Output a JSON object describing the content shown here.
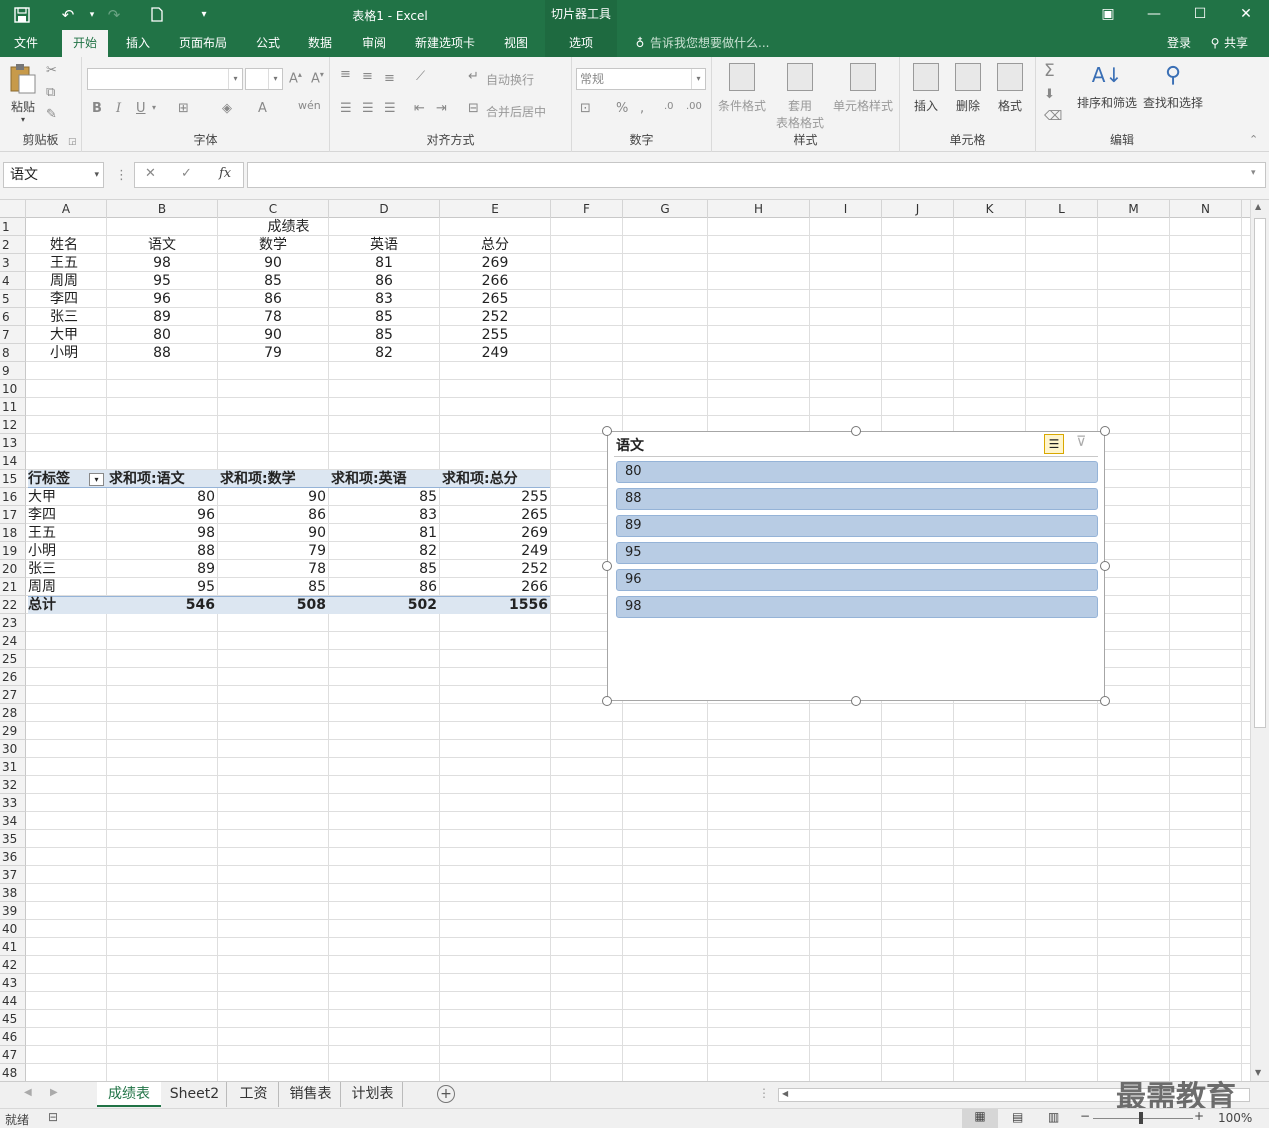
{
  "window": {
    "title": "表格1 - Excel",
    "context_tool": "切片器工具",
    "login": "登录",
    "share": "共享"
  },
  "ribbon_tabs": [
    "文件",
    "开始",
    "插入",
    "页面布局",
    "公式",
    "数据",
    "审阅",
    "新建选项卡",
    "视图",
    "选项"
  ],
  "active_tab": "开始",
  "tell_me": "告诉我您想要做什么...",
  "ribbon": {
    "clipboard": {
      "label": "剪贴板",
      "paste": "粘贴"
    },
    "font": {
      "label": "字体"
    },
    "align": {
      "label": "对齐方式",
      "wrap": "自动换行",
      "merge": "合并后居中"
    },
    "number": {
      "label": "数字",
      "format": "常规"
    },
    "styles": {
      "label": "样式",
      "cond": "条件格式",
      "table1": "套用",
      "table2": "表格格式",
      "cell_style": "单元格样式"
    },
    "cells": {
      "label": "单元格",
      "insert": "插入",
      "delete": "删除",
      "format": "格式"
    },
    "edit": {
      "label": "编辑",
      "sort": "排序和筛选",
      "find": "查找和选择"
    }
  },
  "name_box": "语文",
  "formula_value": "",
  "columns": [
    "A",
    "B",
    "C",
    "D",
    "E",
    "F",
    "G",
    "H",
    "I",
    "J",
    "K",
    "L",
    "M",
    "N"
  ],
  "table": {
    "title": "成绩表",
    "headers": [
      "姓名",
      "语文",
      "数学",
      "英语",
      "总分"
    ],
    "rows": [
      [
        "王五",
        "98",
        "90",
        "81",
        "269"
      ],
      [
        "周周",
        "95",
        "85",
        "86",
        "266"
      ],
      [
        "李四",
        "96",
        "86",
        "83",
        "265"
      ],
      [
        "张三",
        "89",
        "78",
        "85",
        "252"
      ],
      [
        "大甲",
        "80",
        "90",
        "85",
        "255"
      ],
      [
        "小明",
        "88",
        "79",
        "82",
        "249"
      ]
    ]
  },
  "pivot": {
    "headers": [
      "行标签",
      "求和项:语文",
      "求和项:数学",
      "求和项:英语",
      "求和项:总分"
    ],
    "rows": [
      [
        "大甲",
        "80",
        "90",
        "85",
        "255"
      ],
      [
        "李四",
        "96",
        "86",
        "83",
        "265"
      ],
      [
        "王五",
        "98",
        "90",
        "81",
        "269"
      ],
      [
        "小明",
        "88",
        "79",
        "82",
        "249"
      ],
      [
        "张三",
        "89",
        "78",
        "85",
        "252"
      ],
      [
        "周周",
        "95",
        "85",
        "86",
        "266"
      ]
    ],
    "total": [
      "总计",
      "546",
      "508",
      "502",
      "1556"
    ]
  },
  "slicer": {
    "title": "语文",
    "items": [
      "80",
      "88",
      "89",
      "95",
      "96",
      "98"
    ]
  },
  "sheets": [
    "成绩表",
    "Sheet2",
    "工资",
    "销售表",
    "计划表"
  ],
  "active_sheet": "成绩表",
  "status": {
    "ready": "就绪",
    "zoom": "100%"
  },
  "watermark": "最需教育"
}
